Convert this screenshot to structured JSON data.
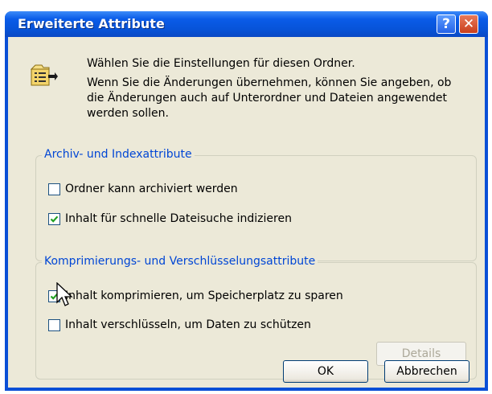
{
  "window": {
    "title": "Erweiterte Attribute",
    "help_label": "?",
    "close_label": "✕"
  },
  "intro": {
    "line1": "Wählen Sie die Einstellungen für diesen Ordner.",
    "line2": "Wenn Sie die Änderungen übernehmen, können Sie angeben, ob",
    "line3": "die Änderungen auch auf Unterordner und Dateien angewendet",
    "line4": "werden sollen."
  },
  "archive_group": {
    "legend": "Archiv- und Indexattribute",
    "options": [
      {
        "label": "Ordner kann archiviert werden",
        "checked": false
      },
      {
        "label": "Inhalt für schnelle Dateisuche indizieren",
        "checked": true
      }
    ]
  },
  "compress_group": {
    "legend": "Komprimierungs- und Verschlüsselungsattribute",
    "options": [
      {
        "label": "Inhalt komprimieren, um Speicherplatz zu sparen",
        "checked": true
      },
      {
        "label": "Inhalt verschlüsseln, um Daten zu schützen",
        "checked": false
      }
    ],
    "details_label": "Details"
  },
  "buttons": {
    "ok_label": "OK",
    "cancel_label": "Abbrechen"
  },
  "colors": {
    "titlebar": "#0a5ce8",
    "legend_text": "#0046d5",
    "dialog_background": "#ece9d8",
    "checkmark": "#21a121"
  }
}
